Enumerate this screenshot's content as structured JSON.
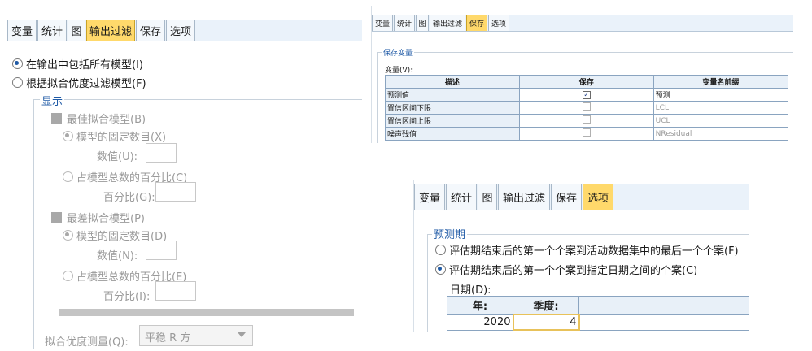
{
  "tabs": [
    "变量",
    "统计",
    "图",
    "输出过滤",
    "保存",
    "选项"
  ],
  "filter": {
    "radio_all": "在输出中包括所有模型(I)",
    "radio_fit": "根据拟合优度过滤模型(F)",
    "display_group": "显示",
    "best_fit_check": "最佳拟合模型(B)",
    "fixed_count_best": "模型的固定数目(X)",
    "number_best": "数值(U):",
    "percent_best": "占模型总数的百分比(C)",
    "percent_label_best": "百分比(G):",
    "worst_fit_check": "最差拟合模型(P)",
    "fixed_count_worst": "模型的固定数目(D)",
    "number_worst": "数值(N):",
    "percent_worst": "占模型总数的百分比(E)",
    "percent_label_worst": "百分比(I):",
    "measure_label": "拟合优度测量(Q):",
    "measure_value": "平稳 R 方"
  },
  "save": {
    "group": "保存变量",
    "variables_label": "变量(V):",
    "headers": [
      "描述",
      "保存",
      "变量名前缀"
    ],
    "rows": [
      {
        "desc": "预测值",
        "checked": true,
        "prefix": "预测"
      },
      {
        "desc": "置信区间下限",
        "checked": false,
        "prefix": "LCL"
      },
      {
        "desc": "置信区间上限",
        "checked": false,
        "prefix": "UCL"
      },
      {
        "desc": "噪声残值",
        "checked": false,
        "prefix": "NResidual"
      }
    ]
  },
  "options": {
    "group": "预测期",
    "radio_last": "评估期结束后的第一个个案到活动数据集中的最后一个个案(F)",
    "radio_date": "评估期结束后的第一个个案到指定日期之间的个案(C)",
    "date_label": "日期(D):",
    "col_year": "年:",
    "col_quarter": "季度:",
    "year_value": "2020",
    "quarter_value": "4"
  },
  "colors": {
    "accent": "#1f5aa6",
    "active_tab": "#ffd96b",
    "tab_strip": "#eaf2fa"
  }
}
